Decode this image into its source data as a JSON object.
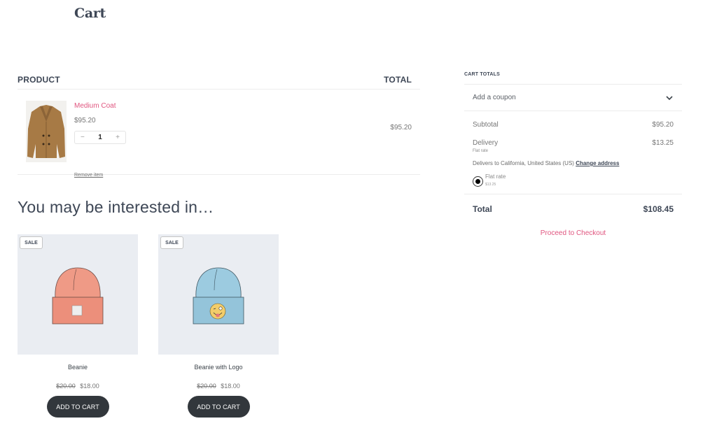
{
  "page": {
    "title": "Cart"
  },
  "cart": {
    "headers": {
      "product": "PRODUCT",
      "total": "TOTAL"
    },
    "items": [
      {
        "name": "Medium Coat",
        "price": "$95.20",
        "quantity": "1",
        "remove_label": "Remove item",
        "line_total": "$95.20",
        "image": "coat-image"
      }
    ]
  },
  "totals": {
    "title": "CART TOTALS",
    "coupon_label": "Add a coupon",
    "subtotal_label": "Subtotal",
    "subtotal_value": "$95.20",
    "delivery_label": "Delivery",
    "delivery_value": "$13.25",
    "delivery_method": "Flat rate",
    "delivers_to": "Delivers to California, United States (US)",
    "change_address": "Change address",
    "shipping_option": {
      "label": "Flat rate",
      "price": "$13.25",
      "selected": true
    },
    "total_label": "Total",
    "total_value": "$108.45",
    "checkout_label": "Proceed to Checkout"
  },
  "recommendations": {
    "title": "You may be interested in…",
    "products": [
      {
        "badge": "SALE",
        "name": "Beanie",
        "regular_price": "$20.00",
        "sale_price": "$18.00",
        "button": "ADD TO CART",
        "color": "#ef9a86"
      },
      {
        "badge": "SALE",
        "name": "Beanie with Logo",
        "regular_price": "$20.00",
        "sale_price": "$18.00",
        "button": "ADD TO CART",
        "color": "#9ccbe0"
      }
    ]
  },
  "colors": {
    "accent": "#e0557f",
    "heading": "#3e4756",
    "button": "#32373c",
    "image_bg": "#eaedf2"
  }
}
